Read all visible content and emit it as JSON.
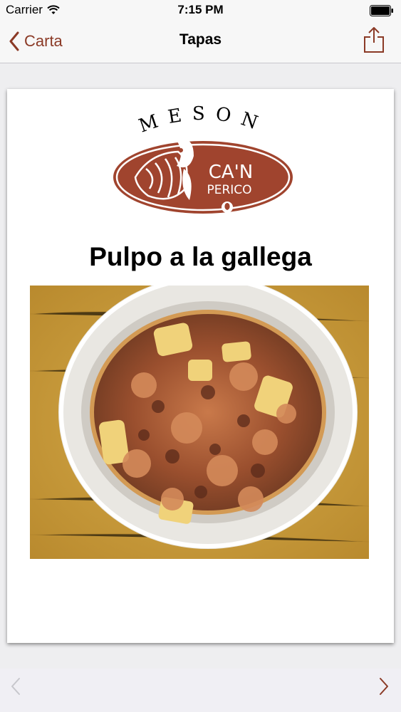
{
  "status_bar": {
    "carrier": "Carrier",
    "time": "7:15 PM"
  },
  "nav": {
    "back_label": "Carta",
    "title": "Tapas"
  },
  "logo": {
    "top_text": "MESON",
    "name_line1": "CA'N",
    "name_line2": "PERICO"
  },
  "dish": {
    "title": "Pulpo a la gallega"
  },
  "icons": {
    "back": "chevron-left-icon",
    "share": "share-icon",
    "prev": "chevron-left-icon",
    "next": "chevron-right-icon",
    "wifi": "wifi-icon",
    "battery": "battery-icon"
  },
  "colors": {
    "accent": "#8b3a26",
    "logo_brown": "#a0442e",
    "disabled": "#c7c7cc"
  }
}
